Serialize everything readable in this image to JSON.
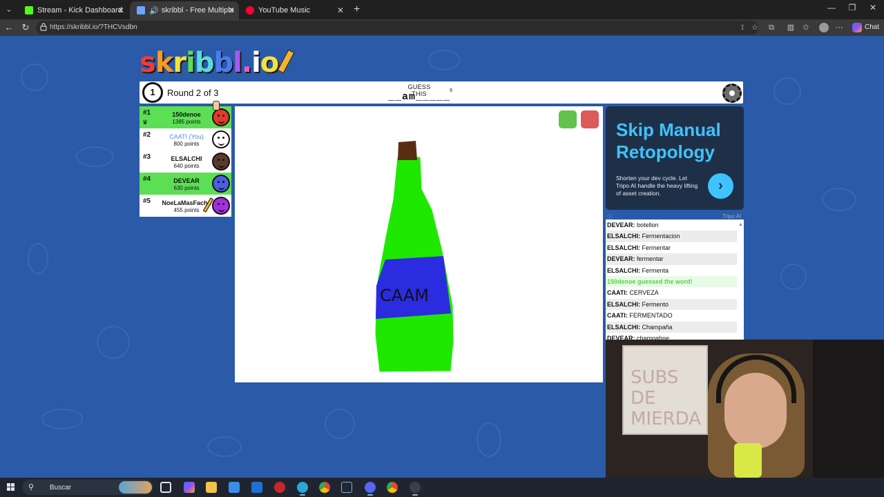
{
  "browser": {
    "tabs": [
      {
        "title": "Stream - Kick Dashboard",
        "favicon_color": "#53fc18",
        "active": false,
        "audio": false
      },
      {
        "title": "skribbl - Free Multiplayer Draw",
        "favicon_color": "#6aa6ff",
        "active": true,
        "audio": true
      },
      {
        "title": "YouTube Music",
        "favicon_color": "#ff0033",
        "active": false,
        "audio": false
      }
    ],
    "url": "https://skribbl.io/?THCVsdbn",
    "chat_label": "Chat"
  },
  "game": {
    "logo_text": "skribbl.io",
    "logo_colors": [
      "#f53a3a",
      "#f59b24",
      "#f5e13a",
      "#5be04b",
      "#5bd9e0",
      "#4a7cf0",
      "#a45bf0",
      "#f05bc7",
      "#ffffff",
      "#f5e13a"
    ],
    "timer": "1",
    "round_text": "Round 2 of 3",
    "guess_label": "GUESS THIS",
    "word_hint": "__am_____",
    "word_length": "9",
    "players": [
      {
        "rank": "#1",
        "name": "150denoe",
        "points": "1385 points",
        "highlight": true,
        "you": false,
        "avatar_color": "#e23a2a",
        "crown": true,
        "drawing": false
      },
      {
        "rank": "#2",
        "name": "CAATI (You)",
        "points": "800 points",
        "highlight": false,
        "you": true,
        "avatar_color": "#ffffff",
        "crown": false,
        "drawing": false
      },
      {
        "rank": "#3",
        "name": "ELSALCHI",
        "points": "640 points",
        "highlight": false,
        "you": false,
        "avatar_color": "#5a3a2a",
        "crown": false,
        "drawing": false
      },
      {
        "rank": "#4",
        "name": "DEVEAR",
        "points": "630 points",
        "highlight": true,
        "you": false,
        "avatar_color": "#4a5ee0",
        "crown": false,
        "drawing": false
      },
      {
        "rank": "#5",
        "name": "NoeLaMasFacha",
        "points": "455 points",
        "highlight": false,
        "you": false,
        "avatar_color": "#a52fe0",
        "crown": false,
        "drawing": true
      }
    ],
    "canvas": {
      "drawing_text": "CAAM"
    },
    "ad": {
      "title": "Skip Manual Retopology",
      "body": "Shorten your dev cycle. Let Tripo AI handle the heavy lifting of asset creation.",
      "button_icon": "chevron-right-icon",
      "info_icon": "info-icon",
      "source": "Tripo AI"
    },
    "chat": [
      {
        "user": "DEVEAR:",
        "text": "botellon",
        "correct": false
      },
      {
        "user": "ELSALCHI:",
        "text": "Fermentacion",
        "correct": false
      },
      {
        "user": "ELSALCHI:",
        "text": "Fermentar",
        "correct": false
      },
      {
        "user": "DEVEAR:",
        "text": "fermentar",
        "correct": false
      },
      {
        "user": "ELSALCHI:",
        "text": "Fermenta",
        "correct": false
      },
      {
        "user": "",
        "text": "150denoe guessed the word!",
        "correct": true
      },
      {
        "user": "CAATI:",
        "text": "CERVEZA",
        "correct": false
      },
      {
        "user": "ELSALCHI:",
        "text": "Fermento",
        "correct": false
      },
      {
        "user": "CAATI:",
        "text": "FERMENTADO",
        "correct": false
      },
      {
        "user": "ELSALCHI:",
        "text": "Champaña",
        "correct": false
      },
      {
        "user": "DEVEAR:",
        "text": "champahne",
        "correct": false
      }
    ]
  },
  "webcam": {
    "whiteboard_text": "SUBS DE MIERDA"
  },
  "taskbar": {
    "search_placeholder": "Buscar"
  }
}
